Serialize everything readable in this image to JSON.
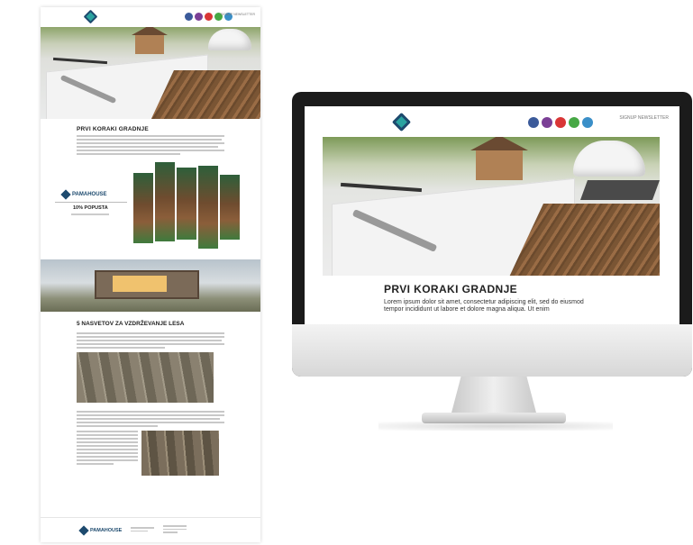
{
  "newsletter": {
    "top_link": "SIGNUP NEWSLETTER",
    "social_icons": [
      "facebook-icon",
      "instagram-icon",
      "youtube-icon",
      "whatsapp-icon",
      "telegram-icon"
    ],
    "social_colors": [
      "#3b5a9a",
      "#7b3f96",
      "#d93636",
      "#47a845",
      "#3a8fc8"
    ],
    "section1_title": "PRVI KORAKI GRADNJE",
    "promo_brand": "PAMAHOUSE",
    "promo_discount": "10% POPUSTA",
    "section2_title": "5 NASVETOV ZA VZDRŽEVANJE LESA",
    "footer_brand": "PAMAHOUSE"
  },
  "monitor": {
    "top_link": "SIGNUP NEWSLETTER",
    "headline": "PRVI KORAKI GRADNJE",
    "body": "Lorem ipsum dolor sit amet, consectetur adipiscing elit, sed do eiusmod tempor incididunt ut labore et dolore magna aliqua. Ut enim"
  },
  "colors": {
    "brand_dark": "#1d4a6e",
    "brand_teal": "#2aa3a0"
  }
}
